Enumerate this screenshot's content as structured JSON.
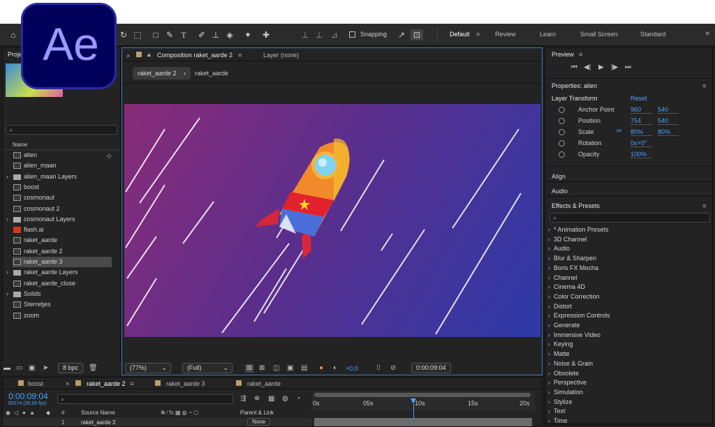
{
  "topbar": {
    "home_icon": "home-icon",
    "snapping_label": "Snapping",
    "workspaces": [
      "Default",
      "Review",
      "Learn",
      "Small Screen",
      "Standard"
    ],
    "more": "»"
  },
  "logo": {
    "text": "Ae"
  },
  "project": {
    "title": "Project",
    "search_placeholder": "",
    "column_name": "Name",
    "items": [
      {
        "label": "alien",
        "type": "comp"
      },
      {
        "label": "alien_maan",
        "type": "comp"
      },
      {
        "label": "alien_maan Layers",
        "type": "folder"
      },
      {
        "label": "boost",
        "type": "comp"
      },
      {
        "label": "cosmonaut",
        "type": "comp"
      },
      {
        "label": "cosmonaut 2",
        "type": "comp"
      },
      {
        "label": "cosmonaut Layers",
        "type": "folder"
      },
      {
        "label": "flash.ai",
        "type": "ai"
      },
      {
        "label": "raket_aarde",
        "type": "comp"
      },
      {
        "label": "raket_aarde 2",
        "type": "comp"
      },
      {
        "label": "raket_aarde 3",
        "type": "comp",
        "selected": true
      },
      {
        "label": "raket_aarde Layers",
        "type": "folder"
      },
      {
        "label": "raket_aarde_close",
        "type": "comp"
      },
      {
        "label": "Solids",
        "type": "folder"
      },
      {
        "label": "Sterretjes",
        "type": "comp"
      },
      {
        "label": "zoom",
        "type": "comp"
      }
    ],
    "bpc": "8 bpc"
  },
  "composition": {
    "tab_title": "Composition raket_aarde 2",
    "layer_tab": "Layer (none)",
    "breadcrumb_active": "raket_aarde 2",
    "breadcrumb_next": "raket_aarde",
    "zoom": "(77%)",
    "resolution": "(Full)",
    "exposure": "+0,0",
    "timecode": "0:00:09:04"
  },
  "preview": {
    "title": "Preview"
  },
  "properties": {
    "title": "Properties: alien",
    "section": "Layer Transform",
    "reset": "Reset",
    "rows": [
      {
        "label": "Anchor Point",
        "v1": "960",
        "v2": "540"
      },
      {
        "label": "Position",
        "v1": "754",
        "v2": "540"
      },
      {
        "label": "Scale",
        "v1": "80%",
        "v2": "80%"
      },
      {
        "label": "Rotation",
        "v1": "0x+0°",
        "v2": ""
      },
      {
        "label": "Opacity",
        "v1": "100%",
        "v2": ""
      }
    ]
  },
  "align": {
    "title": "Align"
  },
  "audio": {
    "title": "Audio"
  },
  "effects": {
    "title": "Effects & Presets",
    "items": [
      "* Animation Presets",
      "3D Channel",
      "Audio",
      "Blur & Sharpen",
      "Boris FX Mocha",
      "Channel",
      "Cinema 4D",
      "Color Correction",
      "Distort",
      "Expression Controls",
      "Generate",
      "Immersive Video",
      "Keying",
      "Matte",
      "Noise & Grain",
      "Obsolete",
      "Perspective",
      "Simulation",
      "Stylize",
      "Text",
      "Time"
    ]
  },
  "timeline": {
    "tabs": [
      "boost",
      "raket_aarde 2",
      "raket_aarde 3",
      "raket_aarde"
    ],
    "timecode": "0:00:09:04",
    "frames": "00274 (30.00 fps)",
    "ruler": [
      "0s",
      "05s",
      "10s",
      "15s",
      "20s"
    ],
    "col_source": "Source Name",
    "col_parent": "Parent & Link",
    "row_name": "raket_aarde 3",
    "row_num": "1",
    "row_parent": "None",
    "playhead_fraction": 0.458
  },
  "colors": {
    "accent": "#4aa3ff",
    "logo_bg": "#00005b",
    "logo_fg": "#9999ff"
  }
}
